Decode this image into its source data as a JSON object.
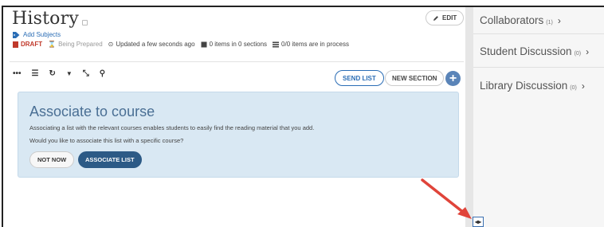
{
  "header": {
    "title": "History",
    "edit_label": "EDIT",
    "add_subjects": "Add Subjects"
  },
  "meta": {
    "draft": "DRAFT",
    "being_prepared": "Being Prepared",
    "updated": "Updated a few seconds ago",
    "items": "0 items in 0 sections",
    "process": "0/0 items are in process"
  },
  "toolbar": {
    "more_icon": "•••",
    "list_icon": "☰",
    "refresh_icon": "↻",
    "filter_icon": "▼",
    "collapse_icon": "⤡",
    "search_icon": "⚲",
    "send_list": "SEND LIST",
    "new_section": "NEW SECTION",
    "add_label": "+"
  },
  "associate": {
    "title": "Associate to course",
    "description": "Associating a list with the relevant courses enables students to easily find the reading material that you add.",
    "question": "Would you like to associate this list with a specific course?",
    "not_now": "NOT NOW",
    "associate_list": "ASSOCIATE LIST"
  },
  "sidebar": {
    "items": [
      {
        "label": "Collaborators",
        "count": "(1)",
        "chevron": "›"
      },
      {
        "label": "Student Discussion",
        "count": "(0)",
        "chevron": "›"
      },
      {
        "label": "Library Discussion",
        "count": "(0)",
        "chevron": "›"
      }
    ]
  },
  "split_handle": "◂▸",
  "colors": {
    "accent": "#2a6db5",
    "associate_button": "#2c5a86",
    "panel_bg": "#d9e8f3",
    "draft": "#c0392b",
    "arrow": "#e0443a"
  }
}
